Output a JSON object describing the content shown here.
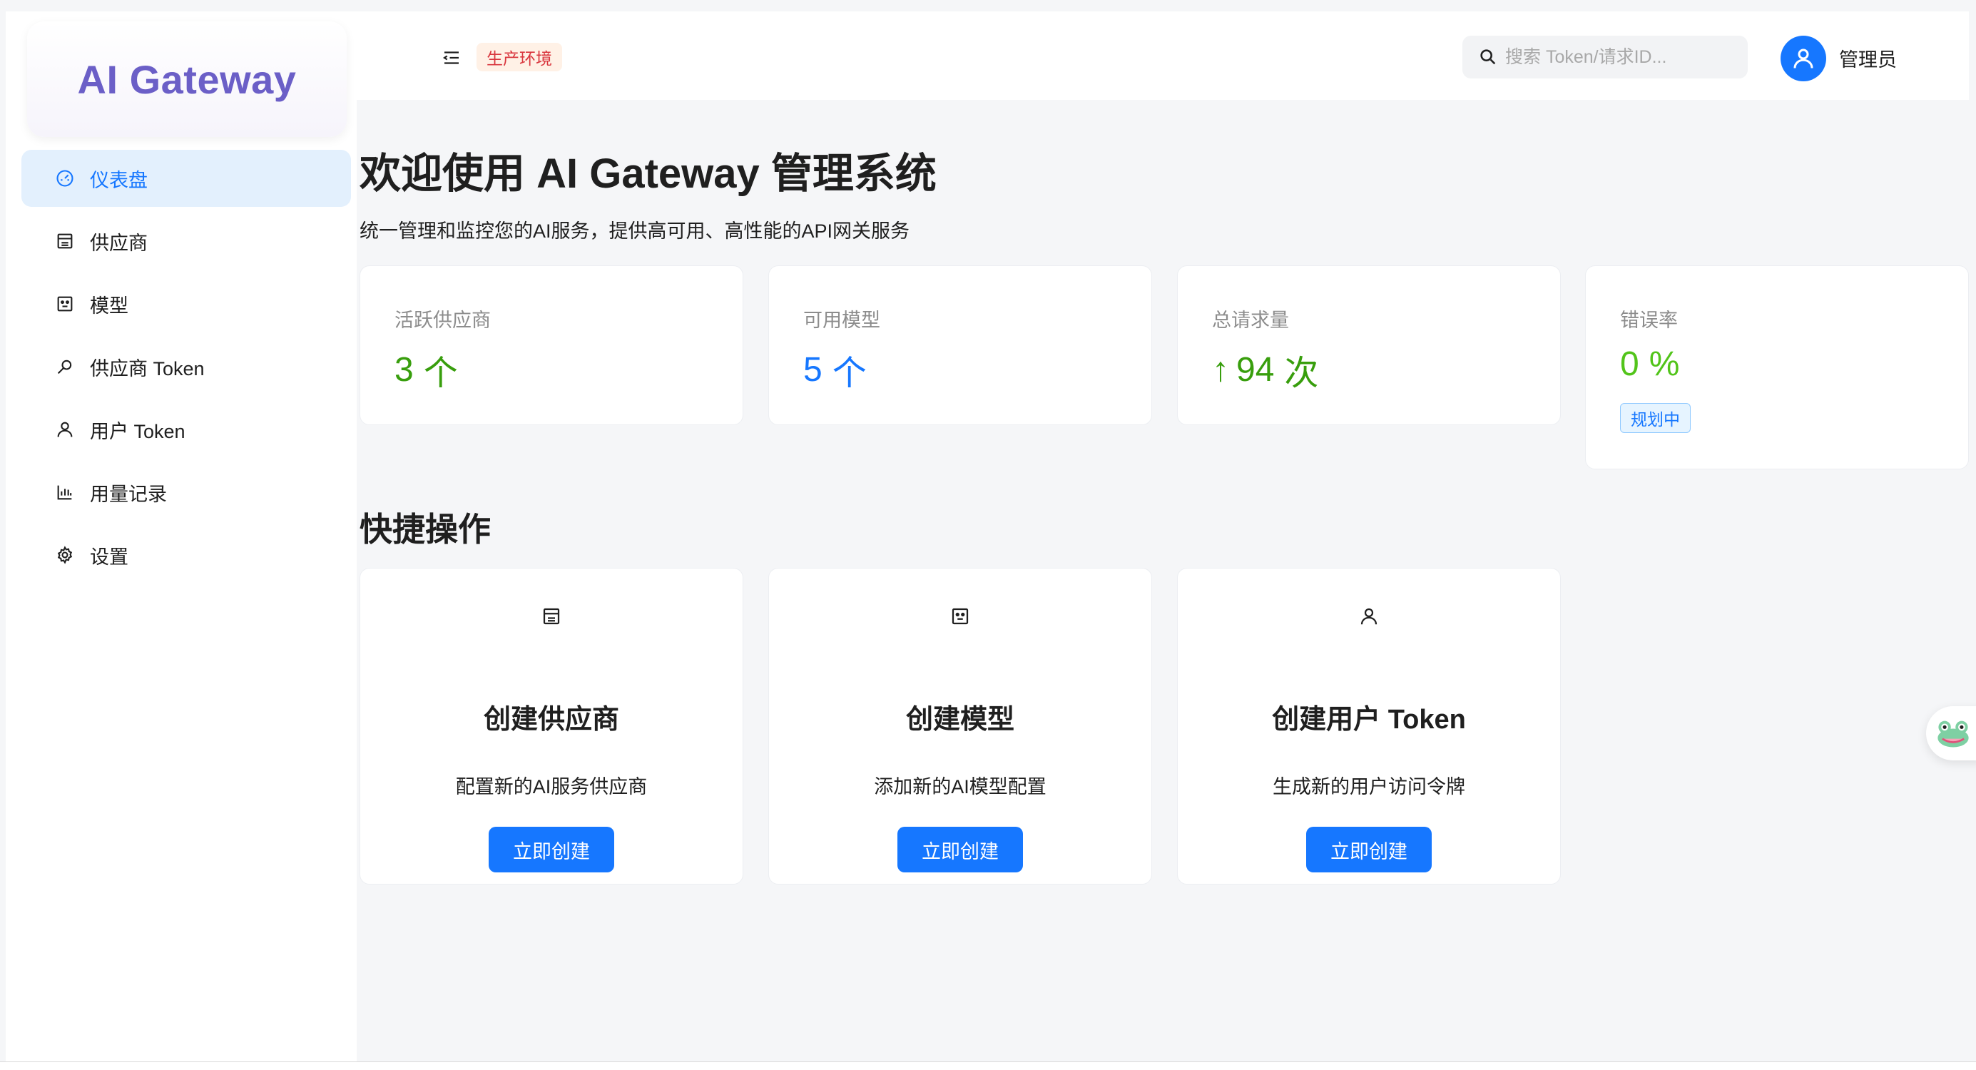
{
  "brand": {
    "logo_text": "AI Gateway",
    "accent": "#1677ff",
    "logo_color": "#6b5fc7"
  },
  "sidebar": {
    "items": [
      {
        "label": "仪表盘",
        "icon": "dashboard-icon",
        "active": true
      },
      {
        "label": "供应商",
        "icon": "store-icon",
        "active": false
      },
      {
        "label": "模型",
        "icon": "robot-icon",
        "active": false
      },
      {
        "label": "供应商 Token",
        "icon": "key-icon",
        "active": false
      },
      {
        "label": "用户 Token",
        "icon": "user-icon",
        "active": false
      },
      {
        "label": "用量记录",
        "icon": "bar-chart-icon",
        "active": false
      },
      {
        "label": "设置",
        "icon": "gear-icon",
        "active": false
      }
    ]
  },
  "header": {
    "env_tag": "生产环境",
    "search": {
      "placeholder": "搜索 Token/请求ID..."
    },
    "user_name": "管理员"
  },
  "main": {
    "welcome_title": "欢迎使用 AI Gateway 管理系统",
    "welcome_subtitle": "统一管理和监控您的AI服务，提供高可用、高性能的API网关服务",
    "stats": [
      {
        "label": "活跃供应商",
        "value": "3",
        "unit": "个",
        "color": "#389e0d"
      },
      {
        "label": "可用模型",
        "value": "5",
        "unit": "个",
        "color": "#1677ff"
      },
      {
        "label": "总请求量",
        "prefix": "↑",
        "value": "94",
        "unit": "次",
        "color": "#389e0d"
      },
      {
        "label": "错误率",
        "value": "0",
        "unit": "%",
        "color": "#52c41a",
        "tag": "规划中"
      }
    ],
    "quick_actions_title": "快捷操作",
    "actions": [
      {
        "title": "创建供应商",
        "desc": "配置新的AI服务供应商",
        "button": "立即创建",
        "icon": "store-icon"
      },
      {
        "title": "创建模型",
        "desc": "添加新的AI模型配置",
        "button": "立即创建",
        "icon": "robot-icon"
      },
      {
        "title": "创建用户 Token",
        "desc": "生成新的用户访问令牌",
        "button": "立即创建",
        "icon": "user-icon"
      }
    ]
  }
}
